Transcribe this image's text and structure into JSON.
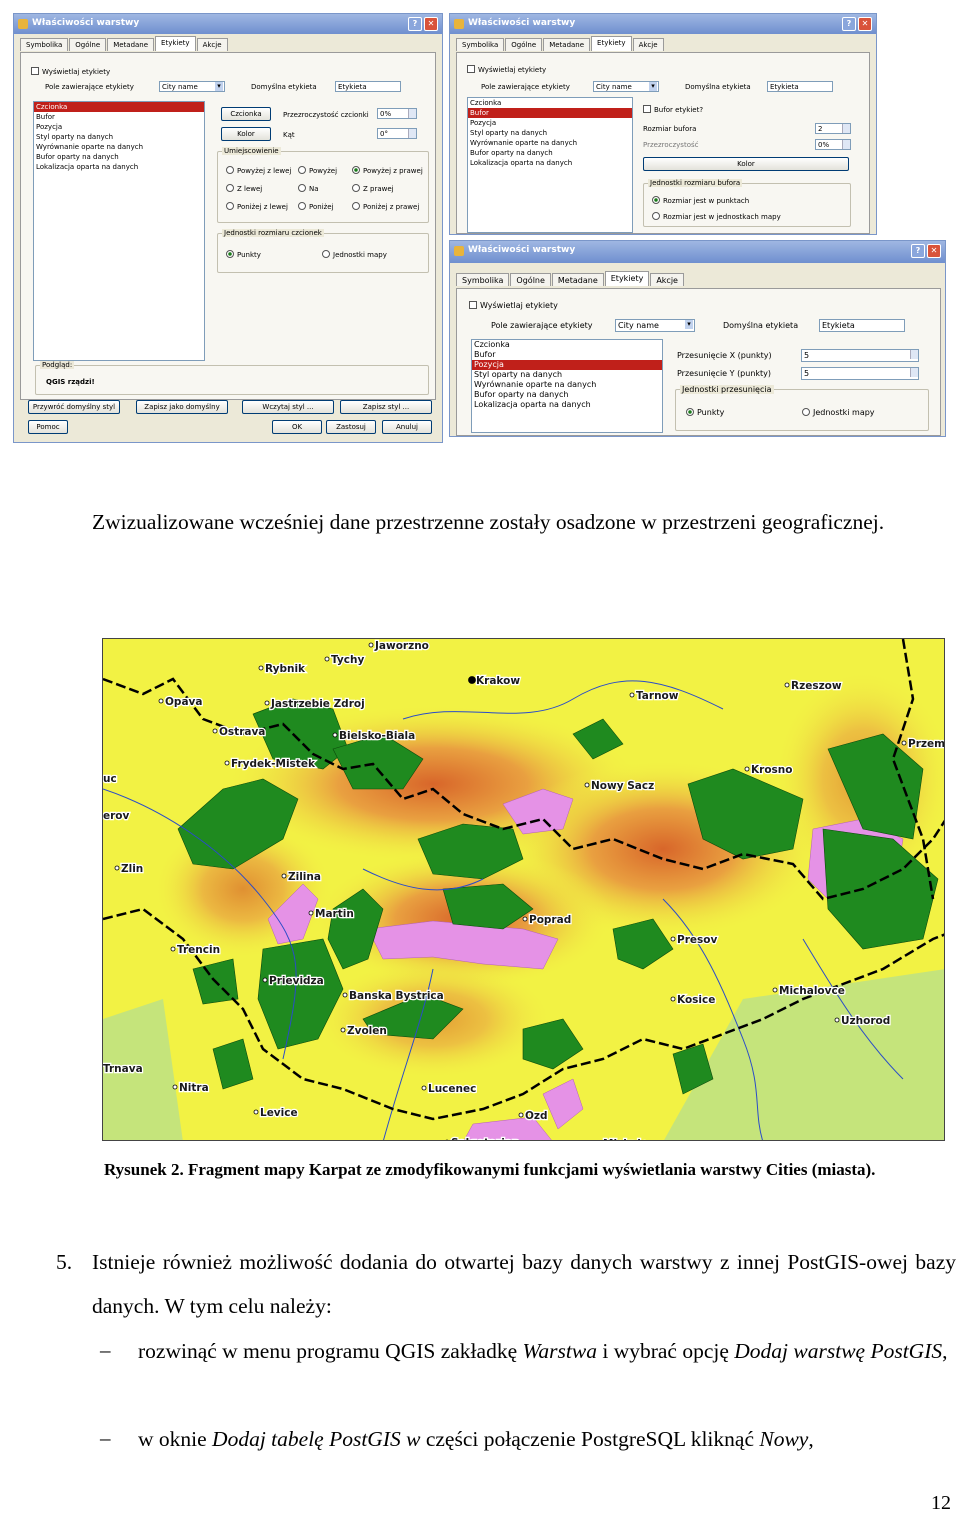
{
  "dialog1": {
    "title": "Właściwości warstwy",
    "tabs": [
      "Symbolika",
      "Ogólne",
      "Metadane",
      "Etykiety",
      "Akcje"
    ],
    "show_labels": "Wyświetlaj etykiety",
    "label_field_label": "Pole zawierające etykiety",
    "label_field_value": "City name",
    "default_label_label": "Domyślna etykieta",
    "default_label_value": "Etykieta",
    "list_items": [
      "Czcionka",
      "Bufor",
      "Pozycja",
      "Styl oparty na danych",
      "Wyrównanie oparte na danych",
      "Bufor oparty na danych",
      "Lokalizacja oparta na danych"
    ],
    "font_button": "Czcionka",
    "color_button": "Kolor",
    "transparency_label": "Przezroczystość czcionki",
    "transparency_value": "0%",
    "angle_label": "Kąt",
    "angle_value": "0°",
    "placement_group": "Umiejscowienie",
    "placements": [
      "Powyżej z lewej",
      "Powyżej",
      "Powyżej z prawej",
      "Z lewej",
      "Na",
      "Z prawej",
      "Poniżej z lewej",
      "Poniżej",
      "Poniżej z prawej"
    ],
    "font_units_group": "Jednostki rozmiaru czcionek",
    "unit_points": "Punkty",
    "unit_map": "Jednostki mapy",
    "preview_label": "Podgląd:",
    "preview_text": "QGIS rządzi!",
    "bottom_buttons": [
      "Przywróć domyślny styl",
      "Zapisz jako domyślny",
      "Wczytaj styl ...",
      "Zapisz styl ..."
    ],
    "help_button": "Pomoc",
    "ok_button": "OK",
    "apply_button": "Zastosuj",
    "cancel_button": "Anuluj"
  },
  "dialog2": {
    "title": "Właściwości warstwy",
    "tabs": [
      "Symbolika",
      "Ogólne",
      "Metadane",
      "Etykiety",
      "Akcje"
    ],
    "show_labels": "Wyświetlaj etykiety",
    "label_field_label": "Pole zawierające etykiety",
    "label_field_value": "City name",
    "default_label_label": "Domyślna etykieta",
    "default_label_value": "Etykieta",
    "list_items": [
      "Czcionka",
      "Bufor",
      "Pozycja",
      "Styl oparty na danych",
      "Wyrównanie oparte na danych",
      "Bufor oparty na danych",
      "Lokalizacja oparta na danych"
    ],
    "buffer_check": "Bufor etykiet?",
    "buffer_size_label": "Rozmiar bufora",
    "buffer_size_value": "2",
    "transparency_label": "Przezroczystość",
    "transparency_value": "0%",
    "color_button": "Kolor",
    "buffer_units_group": "Jednostki rozmiaru bufora",
    "unit_points": "Rozmiar jest w punktach",
    "unit_map": "Rozmiar jest w jednostkach mapy"
  },
  "dialog3": {
    "title": "Właściwości warstwy",
    "tabs": [
      "Symbolika",
      "Ogólne",
      "Metadane",
      "Etykiety",
      "Akcje"
    ],
    "show_labels": "Wyświetlaj etykiety",
    "label_field_label": "Pole zawierające etykiety",
    "label_field_value": "City name",
    "default_label_label": "Domyślna etykieta",
    "default_label_value": "Etykieta",
    "list_items": [
      "Czcionka",
      "Bufor",
      "Pozycja",
      "Styl oparty na danych",
      "Wyrównanie oparte na danych",
      "Bufor oparty na danych",
      "Lokalizacja oparta na danych"
    ],
    "offset_x_label": "Przesunięcie X (punkty)",
    "offset_x_value": "5",
    "offset_y_label": "Przesunięcie Y (punkty)",
    "offset_y_value": "5",
    "offset_units_group": "Jednostki przesunięcia",
    "unit_points": "Punkty",
    "unit_map": "Jednostki mapy"
  },
  "text": {
    "intro": "Zwizualizowane wcześniej dane przestrzenne zostały osadzone w przestrzeni geograficznej.",
    "caption": "Rysunek 2. Fragment mapy Karpat ze zmodyfikowanymi funkcjami wyświetlania warstwy Cities (miasta).",
    "item5_number": "5.",
    "item5_text": "Istnieje również możliwość dodania do otwartej bazy danych warstwy z innej PostGIS-owej bazy danych. W tym celu należy:",
    "bullet_mark": "–",
    "bullet1_a": "rozwinąć w menu programu QGIS zakładkę ",
    "bullet1_b": "Warstwa",
    "bullet1_c": " i wybrać opcję ",
    "bullet1_d": "Dodaj warstwę PostGIS",
    "bullet1_e": ",",
    "bullet2_a": "w oknie ",
    "bullet2_b": "Dodaj tabelę PostGIS w",
    "bullet2_c": " części połączenie PostgreSQL kliknąć ",
    "bullet2_d": "Nowy",
    "bullet2_e": ",",
    "page_number": "12"
  },
  "map": {
    "colors": {
      "lowland": "#f2f244",
      "upland": "#f0c84a",
      "mountain": "#e8a040",
      "forest": "#1f8a1f",
      "protected": "#e592e6",
      "border": "#000000",
      "river": "#2a4cc8"
    },
    "cities": [
      "Rybnik",
      "Tychy",
      "Jaworzno",
      "Krakow",
      "Tarnow",
      "Rzeszow",
      "Opava",
      "Jastrzebie Zdroj",
      "Ostrava",
      "Bielsko-Biala",
      "Przem",
      "Frydek-Mistek",
      "Krosno",
      "Nowy Sacz",
      "uc",
      "erov",
      "Zlin",
      "Zilina",
      "Martin",
      "Poprad",
      "Presov",
      "Trencin",
      "Prievidza",
      "Banska Bystrica",
      "Kosice",
      "Michalovce",
      "Uzhorod",
      "Zvolen",
      "Trnava",
      "Nitra",
      "Lucenec",
      "Levice",
      "Ozd",
      "Salgotarjan",
      "Miskolc"
    ]
  }
}
